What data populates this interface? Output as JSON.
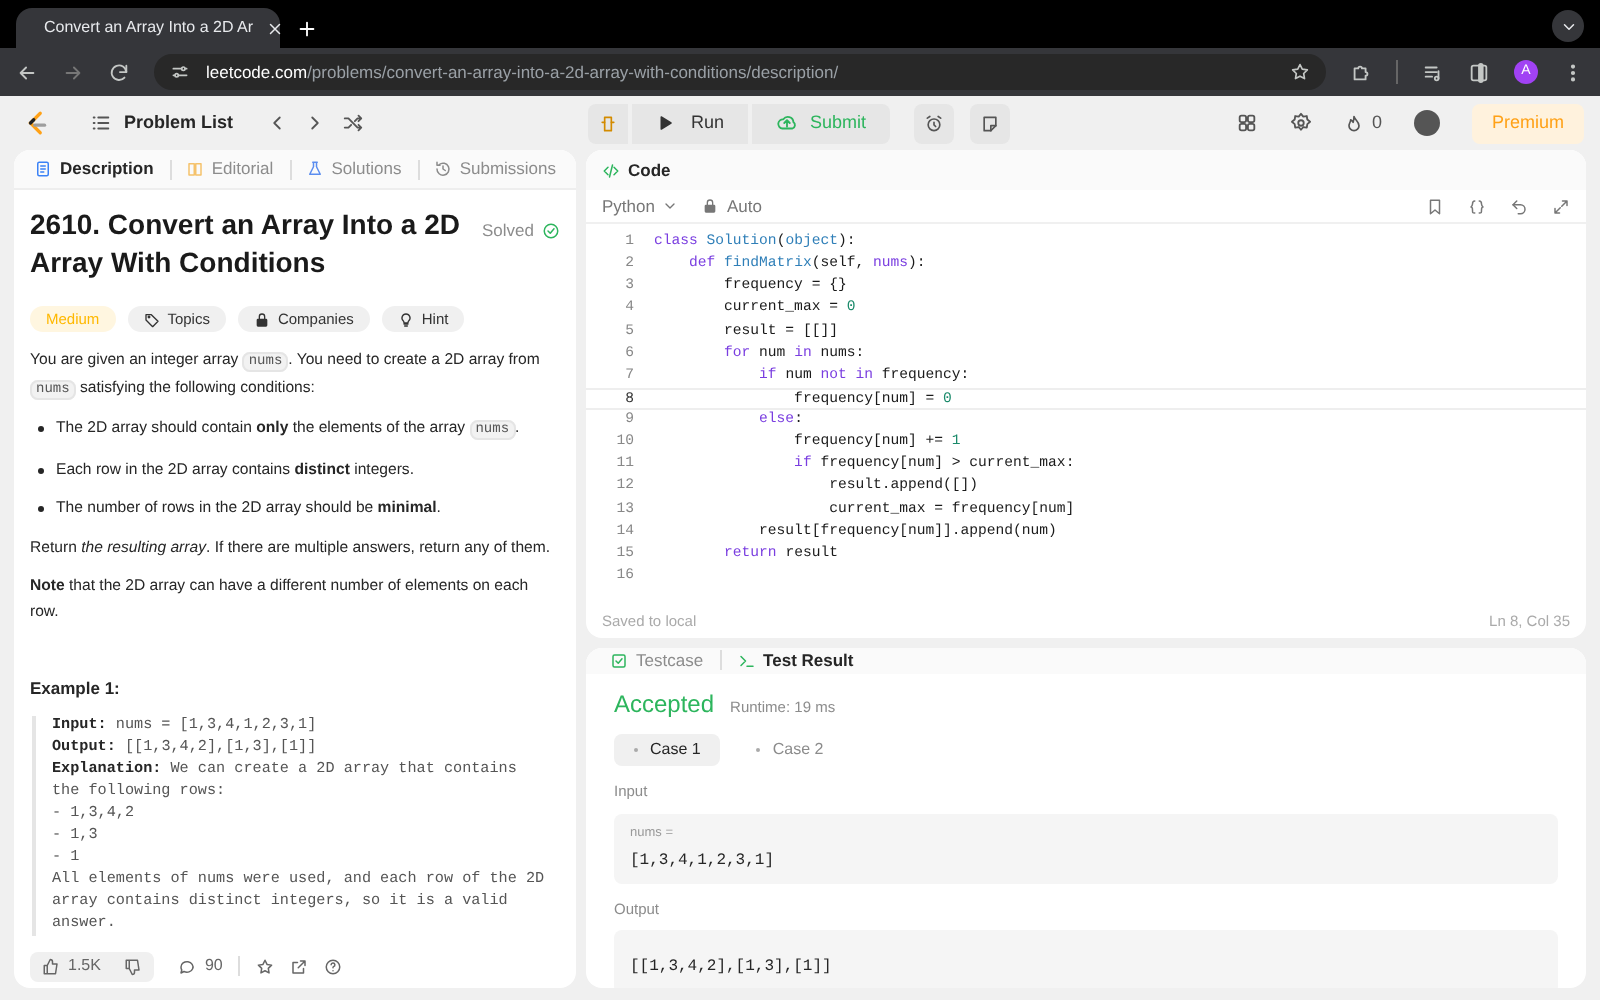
{
  "browser": {
    "tab_title": "Convert an Array Into a 2D Ar",
    "url_host": "leetcode.com",
    "url_path": "/problems/convert-an-array-into-a-2d-array-with-conditions/description/",
    "profile_initial": "A"
  },
  "navbar": {
    "problem_list": "Problem List",
    "run": "Run",
    "submit": "Submit",
    "streak": "0",
    "premium": "Premium"
  },
  "description_panel": {
    "tabs": [
      {
        "label": "Description",
        "selected": true
      },
      {
        "label": "Editorial",
        "selected": false
      },
      {
        "label": "Solutions",
        "selected": false
      },
      {
        "label": "Submissions",
        "selected": false
      }
    ],
    "title": "2610. Convert an Array Into a 2D Array With Conditions",
    "status": "Solved",
    "tags": [
      {
        "label": "Medium",
        "kind": "difficulty"
      },
      {
        "label": "Topics",
        "kind": "topics"
      },
      {
        "label": "Companies",
        "kind": "companies"
      },
      {
        "label": "Hint",
        "kind": "hint"
      }
    ],
    "paragraphs": [
      {
        "kind": "text",
        "parts": [
          {
            "kind": "text",
            "text": "You are given an integer array "
          },
          {
            "kind": "code",
            "text": "nums"
          },
          {
            "kind": "text",
            "text": ". You need to create a 2D array from "
          },
          {
            "kind": "code",
            "text": "nums"
          },
          {
            "kind": "text",
            "text": " satisfying the following conditions:"
          }
        ]
      },
      {
        "kind": "bullet",
        "parts": [
          {
            "kind": "text",
            "text": "The 2D array should contain **only** the elements of the array "
          },
          {
            "kind": "code",
            "text": "nums"
          },
          {
            "kind": "text",
            "text": "."
          }
        ]
      },
      {
        "kind": "bullet",
        "parts": [
          {
            "kind": "text",
            "text": "Each row in the 2D array contains **distinct** integers."
          }
        ]
      },
      {
        "kind": "bullet",
        "parts": [
          {
            "kind": "text",
            "text": "The number of rows in the 2D array should be **minimal**."
          }
        ]
      },
      {
        "kind": "text",
        "parts": [
          {
            "kind": "text",
            "text": "Return *the resulting array*. If there are multiple answers, return any of them."
          }
        ]
      },
      {
        "kind": "text",
        "parts": [
          {
            "kind": "text",
            "text": "**Note** that the 2D array can have a different number of elements on each row."
          }
        ]
      }
    ],
    "example": {
      "title": "Example 1:",
      "lines": [
        "**Input:** nums = [1,3,4,1,2,3,1]",
        "**Output:** [[1,3,4,2],[1,3],[1]]",
        "**Explanation:** We can create a 2D array that contains",
        "the following rows:",
        "- 1,3,4,2",
        "- 1,3",
        "- 1",
        "All elements of nums were used, and each row of the 2D",
        "array contains distinct integers, so it is a valid",
        "answer."
      ]
    },
    "footer": {
      "likes": "1.5K",
      "comments": "90"
    }
  },
  "code_panel": {
    "title": "Code",
    "language": "Python",
    "mode": "Auto",
    "status": "Saved to local",
    "cursor": "Ln 8, Col 35",
    "lines": [
      {
        "number": "1",
        "current": false,
        "tokens": [
          {
            "text": "class",
            "kind": "kw"
          },
          {
            "text": " Solution",
            "kind": "fn"
          },
          {
            "text": "(",
            "kind": "p"
          },
          {
            "text": "object",
            "kind": "fn"
          },
          {
            "text": "):",
            "kind": "p"
          }
        ]
      },
      {
        "number": "2",
        "current": false,
        "tokens": [
          {
            "text": "    def",
            "kind": "kw"
          },
          {
            "text": " findMatrix",
            "kind": "fn"
          },
          {
            "text": "(self, ",
            "kind": "p"
          },
          {
            "text": "nums",
            "kind": "kw"
          },
          {
            "text": "):",
            "kind": "p"
          }
        ]
      },
      {
        "number": "3",
        "current": false,
        "tokens": [
          {
            "text": "        frequency = {}",
            "kind": "p"
          }
        ]
      },
      {
        "number": "4",
        "current": false,
        "tokens": [
          {
            "text": "        current_max = ",
            "kind": "p"
          },
          {
            "text": "0",
            "kind": "num"
          }
        ]
      },
      {
        "number": "5",
        "current": false,
        "tokens": [
          {
            "text": "        result = [[]]",
            "kind": "p"
          }
        ]
      },
      {
        "number": "6",
        "current": false,
        "tokens": [
          {
            "text": "        for",
            "kind": "kw"
          },
          {
            "text": " num ",
            "kind": "p"
          },
          {
            "text": "in",
            "kind": "kw"
          },
          {
            "text": " nums:",
            "kind": "p"
          }
        ]
      },
      {
        "number": "7",
        "current": false,
        "tokens": [
          {
            "text": "            if",
            "kind": "kw"
          },
          {
            "text": " num ",
            "kind": "p"
          },
          {
            "text": "not in",
            "kind": "kw"
          },
          {
            "text": " frequency:",
            "kind": "p"
          }
        ]
      },
      {
        "number": "8",
        "current": true,
        "tokens": [
          {
            "text": "                frequency[num] = ",
            "kind": "p"
          },
          {
            "text": "0",
            "kind": "num"
          }
        ]
      },
      {
        "number": "9",
        "current": false,
        "tokens": [
          {
            "text": "            else",
            "kind": "kw"
          },
          {
            "text": ":",
            "kind": "p"
          }
        ]
      },
      {
        "number": "10",
        "current": false,
        "tokens": [
          {
            "text": "                frequency[num] += ",
            "kind": "p"
          },
          {
            "text": "1",
            "kind": "num"
          }
        ]
      },
      {
        "number": "11",
        "current": false,
        "tokens": [
          {
            "text": "                if",
            "kind": "kw"
          },
          {
            "text": " frequency[num] > current_max:",
            "kind": "p"
          }
        ]
      },
      {
        "number": "12",
        "current": false,
        "tokens": [
          {
            "text": "                    result.append([])",
            "kind": "p"
          }
        ]
      },
      {
        "number": "13",
        "current": false,
        "tokens": [
          {
            "text": "                    current_max = frequency[num]",
            "kind": "p"
          }
        ]
      },
      {
        "number": "14",
        "current": false,
        "tokens": [
          {
            "text": "            result[frequency[num]].append(num)",
            "kind": "p"
          }
        ]
      },
      {
        "number": "15",
        "current": false,
        "tokens": [
          {
            "text": "        return",
            "kind": "kw"
          },
          {
            "text": " result",
            "kind": "p"
          }
        ]
      },
      {
        "number": "16",
        "current": false
      }
    ]
  },
  "result_panel": {
    "tabs": [
      {
        "label": "Testcase",
        "selected": false
      },
      {
        "label": "Test Result",
        "selected": true
      }
    ],
    "verdict": "Accepted",
    "runtime": "Runtime: 19 ms",
    "cases": [
      {
        "label": "Case 1",
        "selected": true
      },
      {
        "label": "Case 2",
        "selected": false
      }
    ],
    "input_label": "Input",
    "input_name": "nums =",
    "input_value": "[1,3,4,1,2,3,1]",
    "output_label": "Output",
    "output_value": "[[1,3,4,2],[1,3],[1]]"
  }
}
